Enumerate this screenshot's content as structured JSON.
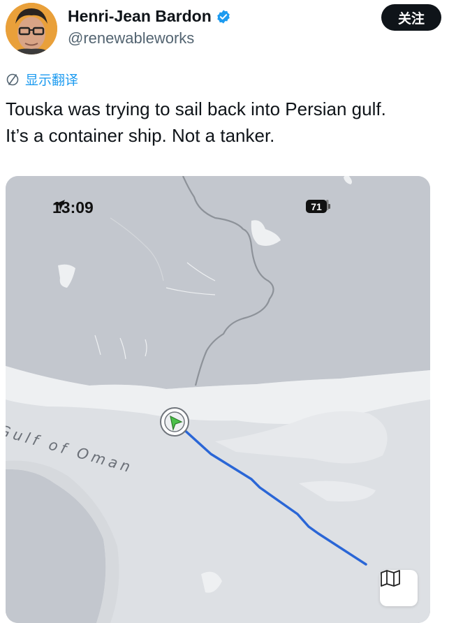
{
  "post": {
    "display_name": "Henri-Jean Bardon",
    "handle": "@renewableworks",
    "follow_label": "关注",
    "translate_label": "显示翻译",
    "text_lines": [
      "Touska was trying to sail back into Persian gulf.",
      "It’s a container ship. Not a tanker."
    ]
  },
  "screenshot": {
    "status_time": "13:09",
    "battery_level": "71",
    "map_label": "Gulf of Oman"
  },
  "colors": {
    "verified": "#1d9bf0",
    "track_line": "#2a66d6",
    "ship_marker": "#4cc04a",
    "land": "#c3c7ce",
    "water": "#dfe2e6"
  },
  "icons": [
    "verified-badge-icon",
    "translate-icon",
    "location-arrow-icon",
    "signal-icon",
    "wifi-icon",
    "battery-icon",
    "map-icon",
    "ship-arrow-icon"
  ]
}
